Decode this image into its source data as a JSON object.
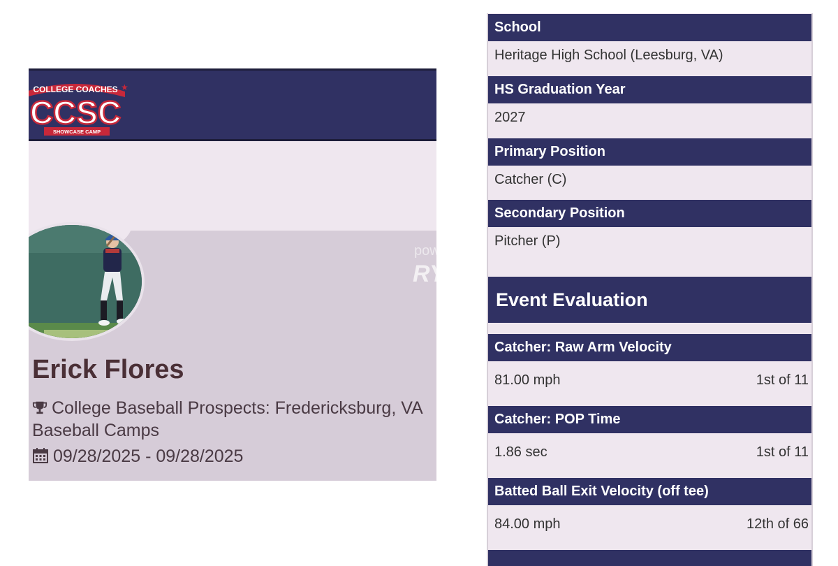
{
  "profile": {
    "logo": {
      "top_text": "COLLEGE COACHES",
      "main_text": "CCSC",
      "bottom_text": "SHOWCASE CAMP"
    },
    "watermark": {
      "line1": "pow",
      "line2": "RY"
    },
    "name": "Erick Flores",
    "event_icon": "trophy-icon",
    "event": "College Baseball Prospects: Fredericksburg, VA Baseball Camps",
    "date_icon": "calendar-icon",
    "dates": "09/28/2025 - 09/28/2025"
  },
  "details": {
    "school": {
      "label": "School",
      "value": "Heritage High School (Leesburg, VA)"
    },
    "grad_year": {
      "label": "HS Graduation Year",
      "value": "2027"
    },
    "primary_position": {
      "label": "Primary Position",
      "value": "Catcher (C)"
    },
    "secondary_position": {
      "label": "Secondary Position",
      "value": "Pitcher (P)"
    }
  },
  "evaluation": {
    "title": "Event Evaluation",
    "metrics": [
      {
        "label": "Catcher: Raw Arm Velocity",
        "value": "81.00 mph",
        "rank": "1st of 11"
      },
      {
        "label": "Catcher: POP Time",
        "value": "1.86 sec",
        "rank": "1st of 11"
      },
      {
        "label": "Batted Ball Exit Velocity (off tee)",
        "value": "84.00 mph",
        "rank": "12th of 66"
      }
    ]
  },
  "colors": {
    "navy": "#303163",
    "light_bg": "#efe7ef",
    "card_bg": "#d6ccd8",
    "name_color": "#4a2f36",
    "logo_red": "#c8283a"
  }
}
